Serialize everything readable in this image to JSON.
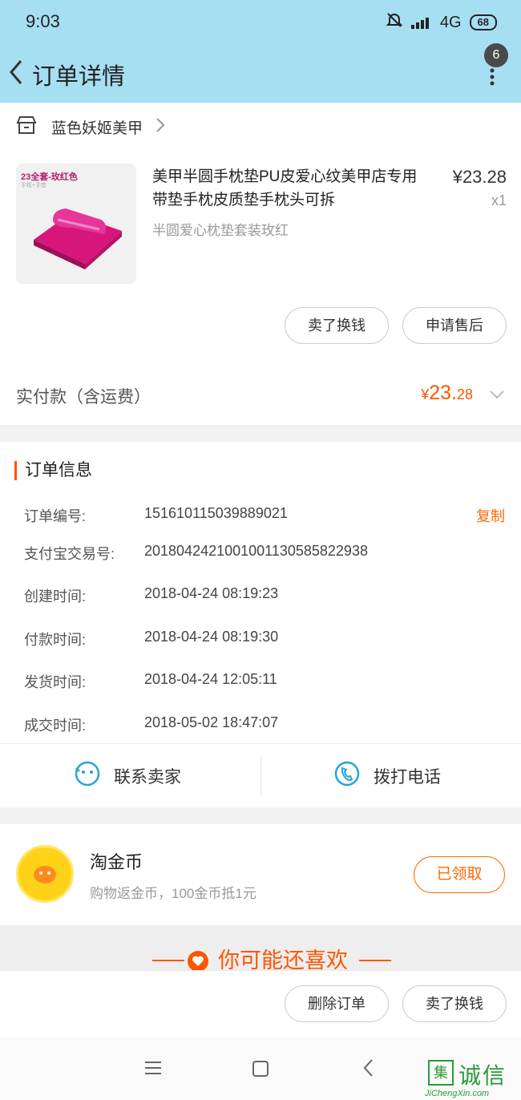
{
  "status_bar": {
    "time": "9:03",
    "network": "4G",
    "battery": "68"
  },
  "header": {
    "title": "订单详情",
    "notification_count": "6"
  },
  "shop": {
    "name": "蓝色妖姬美甲"
  },
  "product": {
    "title": "美甲半圆手枕垫PU皮爱心纹美甲店专用带垫手枕皮质垫手枕头可拆",
    "spec": "半圆爱心枕垫套装玫红",
    "price": "¥23.28",
    "quantity": "x1",
    "image_label": "23全套-玫红色",
    "image_sublabel": "手枕+手垫"
  },
  "item_actions": {
    "sell_label": "卖了换钱",
    "after_sale_label": "申请售后"
  },
  "payment": {
    "label": "实付款（含运费）",
    "currency": "¥",
    "amount_int": "23.",
    "amount_dec": "28"
  },
  "order_info": {
    "title": "订单信息",
    "copy_label": "复制",
    "rows": [
      {
        "label": "订单编号:",
        "value": "151610115039889021"
      },
      {
        "label": "支付宝交易号:",
        "value": "2018042421001001130585822938"
      },
      {
        "label": "创建时间:",
        "value": "2018-04-24 08:19:23"
      },
      {
        "label": "付款时间:",
        "value": "2018-04-24 08:19:30"
      },
      {
        "label": "发货时间:",
        "value": "2018-04-24 12:05:11"
      },
      {
        "label": "成交时间:",
        "value": "2018-05-02 18:47:07"
      }
    ]
  },
  "contact": {
    "seller_label": "联系卖家",
    "phone_label": "拨打电话"
  },
  "coins": {
    "title": "淘金币",
    "subtitle": "购物返金币，100金币抵1元",
    "button_label": "已领取"
  },
  "recommend": {
    "title": "你可能还喜欢"
  },
  "bottom_actions": {
    "delete_label": "删除订单",
    "sell_label": "卖了换钱"
  },
  "watermark": {
    "glyph": "集",
    "text": "诚信",
    "url": "JiChengXin.com"
  },
  "colors": {
    "accent": "#ff5500",
    "header_bg": "#a6def2",
    "icon_blue": "#29a3d8"
  }
}
